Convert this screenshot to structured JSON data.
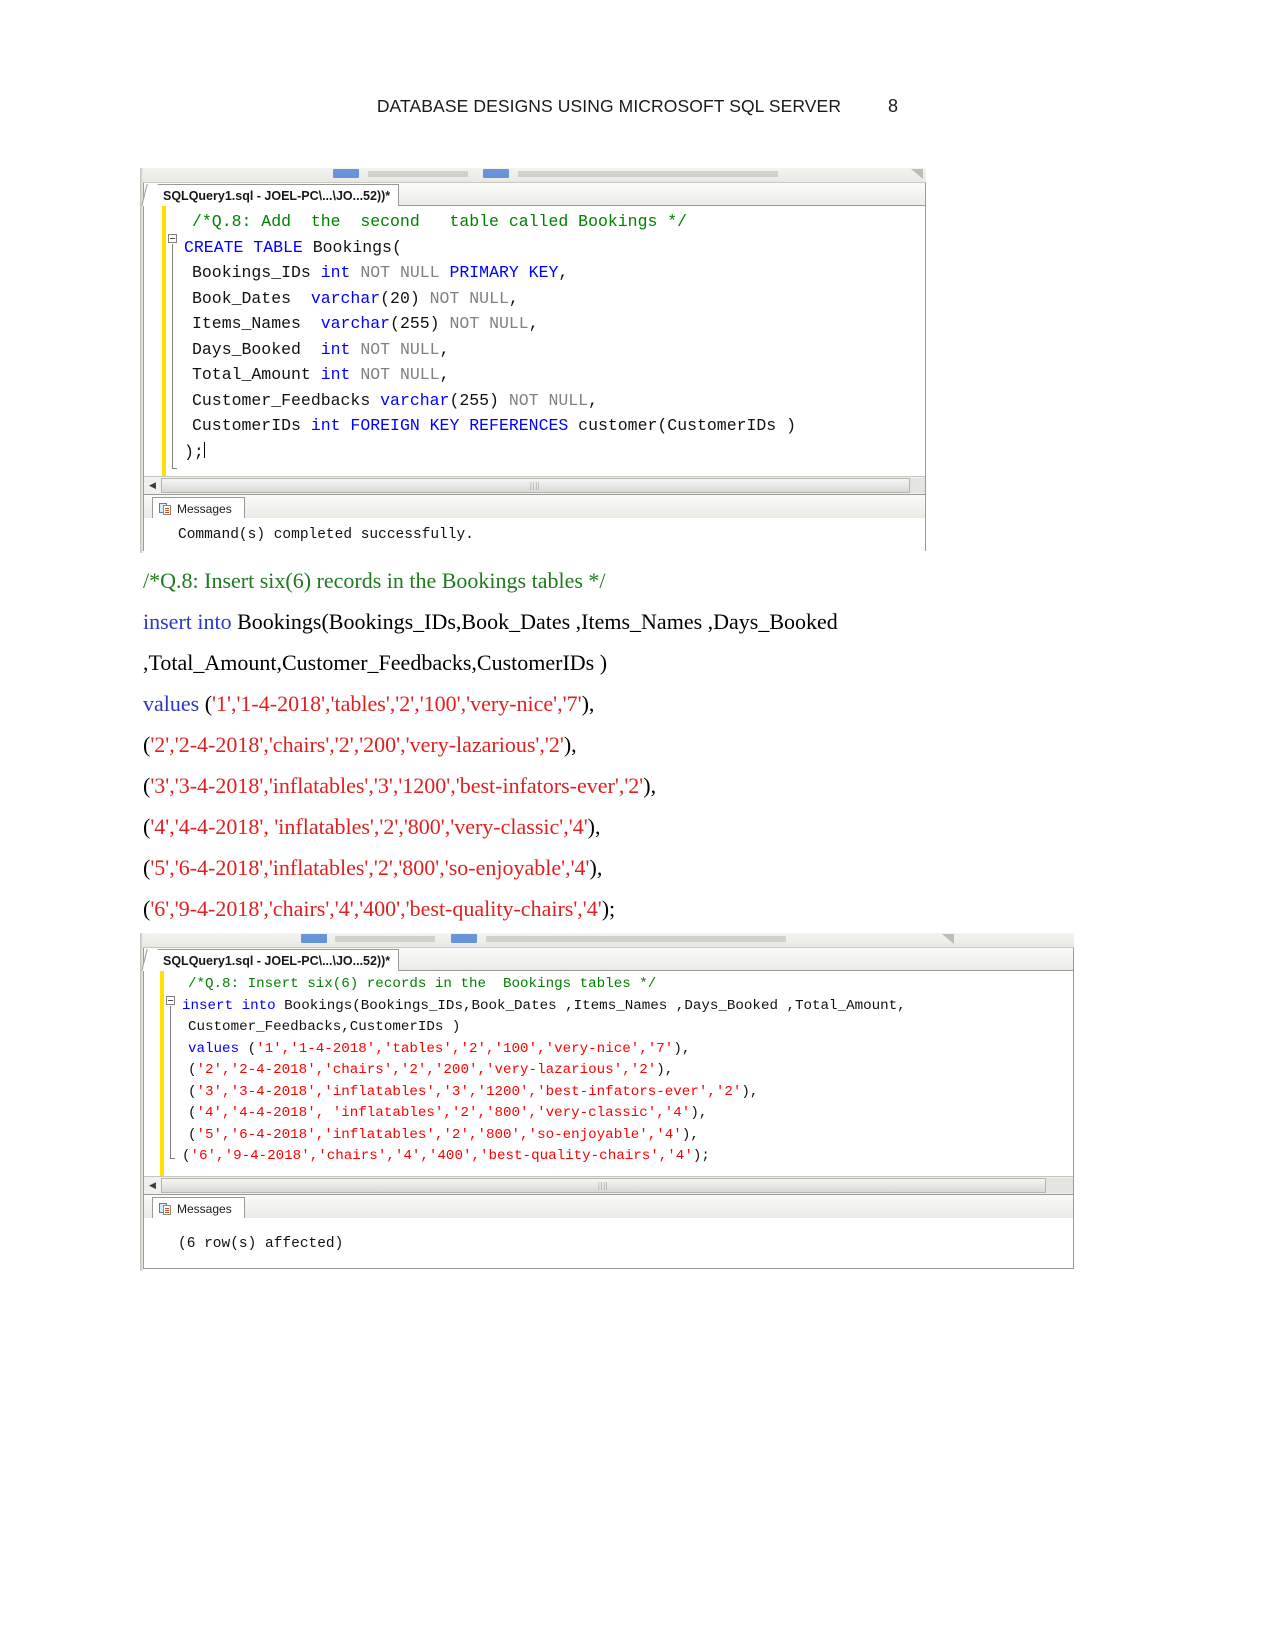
{
  "header": {
    "title": "DATABASE DESIGNS USING MICROSOFT SQL SERVER",
    "page_number": "8"
  },
  "screenshot1": {
    "tab_label": "SQLQuery1.sql - JOEL-PC\\...\\JO...52))*",
    "code_lines": [
      {
        "indent": 1,
        "segments": [
          {
            "t": "/*Q.8: Add  the  second   table called Bookings */",
            "c": "cmt"
          }
        ]
      },
      {
        "indent": 0,
        "segments": [
          {
            "t": "CREATE TABLE ",
            "c": "kw"
          },
          {
            "t": "Bookings(",
            "c": ""
          }
        ]
      },
      {
        "indent": 1,
        "segments": [
          {
            "t": "Bookings_IDs ",
            "c": ""
          },
          {
            "t": "int ",
            "c": "kw"
          },
          {
            "t": "NOT NULL ",
            "c": "grey"
          },
          {
            "t": "PRIMARY KEY",
            "c": "kw"
          },
          {
            "t": ",",
            "c": ""
          }
        ]
      },
      {
        "indent": 1,
        "segments": [
          {
            "t": "Book_Dates  ",
            "c": ""
          },
          {
            "t": "varchar",
            "c": "kw"
          },
          {
            "t": "(20) ",
            "c": ""
          },
          {
            "t": "NOT NULL",
            "c": "grey"
          },
          {
            "t": ",",
            "c": ""
          }
        ]
      },
      {
        "indent": 1,
        "segments": [
          {
            "t": "Items_Names  ",
            "c": ""
          },
          {
            "t": "varchar",
            "c": "kw"
          },
          {
            "t": "(255) ",
            "c": ""
          },
          {
            "t": "NOT NULL",
            "c": "grey"
          },
          {
            "t": ",",
            "c": ""
          }
        ]
      },
      {
        "indent": 1,
        "segments": [
          {
            "t": "Days_Booked  ",
            "c": ""
          },
          {
            "t": "int ",
            "c": "kw"
          },
          {
            "t": "NOT NULL",
            "c": "grey"
          },
          {
            "t": ",",
            "c": ""
          }
        ]
      },
      {
        "indent": 1,
        "segments": [
          {
            "t": "Total_Amount ",
            "c": ""
          },
          {
            "t": "int ",
            "c": "kw"
          },
          {
            "t": "NOT NULL",
            "c": "grey"
          },
          {
            "t": ",",
            "c": ""
          }
        ]
      },
      {
        "indent": 1,
        "segments": [
          {
            "t": "Customer_Feedbacks ",
            "c": ""
          },
          {
            "t": "varchar",
            "c": "kw"
          },
          {
            "t": "(255) ",
            "c": ""
          },
          {
            "t": "NOT NULL",
            "c": "grey"
          },
          {
            "t": ",",
            "c": ""
          }
        ]
      },
      {
        "indent": 1,
        "segments": [
          {
            "t": "CustomerIDs ",
            "c": ""
          },
          {
            "t": "int FOREIGN KEY REFERENCES ",
            "c": "kw"
          },
          {
            "t": "customer(CustomerIDs )",
            "c": ""
          }
        ]
      },
      {
        "indent": 0,
        "segments": [
          {
            "t": ");",
            "c": ""
          }
        ]
      }
    ],
    "messages_tab_label": "Messages",
    "message_text": "Command(s) completed successfully."
  },
  "document_text": {
    "lines": [
      {
        "segments": [
          {
            "t": "/*Q.8: Insert six(6) records in the  Bookings tables */",
            "c": "green"
          }
        ]
      },
      {
        "segments": [
          {
            "t": "insert into ",
            "c": "blue"
          },
          {
            "t": "Bookings(Bookings_IDs,Book_Dates ,Items_Names ,Days_Booked",
            "c": "black"
          }
        ]
      },
      {
        "segments": [
          {
            "t": ",Total_Amount,Customer_Feedbacks,CustomerIDs )",
            "c": "black"
          }
        ]
      },
      {
        "segments": [
          {
            "t": "values ",
            "c": "blue"
          },
          {
            "t": "(",
            "c": "black"
          },
          {
            "t": "'1','1-4-2018','tables','2','100','very-nice','7'",
            "c": "red"
          },
          {
            "t": "),",
            "c": "black"
          }
        ]
      },
      {
        "segments": [
          {
            "t": "(",
            "c": "black"
          },
          {
            "t": "'2','2-4-2018','chairs','2','200','very-lazarious','2'",
            "c": "red"
          },
          {
            "t": "),",
            "c": "black"
          }
        ]
      },
      {
        "segments": [
          {
            "t": "(",
            "c": "black"
          },
          {
            "t": "'3','3-4-2018','inflatables','3','1200','best-infators-ever','2'",
            "c": "red"
          },
          {
            "t": "),",
            "c": "black"
          }
        ]
      },
      {
        "segments": [
          {
            "t": "(",
            "c": "black"
          },
          {
            "t": "'4','4-4-2018', 'inflatables','2','800','very-classic','4'",
            "c": "red"
          },
          {
            "t": "),",
            "c": "black"
          }
        ]
      },
      {
        "segments": [
          {
            "t": "(",
            "c": "black"
          },
          {
            "t": "'5','6-4-2018','inflatables','2','800','so-enjoyable','4'",
            "c": "red"
          },
          {
            "t": "),",
            "c": "black"
          }
        ]
      },
      {
        "segments": [
          {
            "t": "(",
            "c": "black"
          },
          {
            "t": "'6','9-4-2018','chairs','4','400','best-quality-chairs','4'",
            "c": "red"
          },
          {
            "t": ");",
            "c": "black"
          }
        ]
      }
    ]
  },
  "screenshot2": {
    "tab_label": "SQLQuery1.sql - JOEL-PC\\...\\JO...52))*",
    "code_lines": [
      {
        "indent": 1,
        "segments": [
          {
            "t": "/*Q.8: Insert six(6) records in the  Bookings tables */",
            "c": "cmt"
          }
        ]
      },
      {
        "indent": 0,
        "segments": [
          {
            "t": "insert into ",
            "c": "kw"
          },
          {
            "t": "Bookings(Bookings_IDs,Book_Dates ,Items_Names ,Days_Booked ,Total_Amount,",
            "c": ""
          }
        ]
      },
      {
        "indent": 1,
        "segments": [
          {
            "t": "Customer_Feedbacks,CustomerIDs )",
            "c": ""
          }
        ]
      },
      {
        "indent": 1,
        "segments": [
          {
            "t": "values ",
            "c": "kw"
          },
          {
            "t": "(",
            "c": ""
          },
          {
            "t": "'1','1-4-2018','tables','2','100','very-nice','7'",
            "c": "str"
          },
          {
            "t": "),",
            "c": ""
          }
        ]
      },
      {
        "indent": 1,
        "segments": [
          {
            "t": "(",
            "c": ""
          },
          {
            "t": "'2','2-4-2018','chairs','2','200','very-lazarious','2'",
            "c": "str"
          },
          {
            "t": "),",
            "c": ""
          }
        ]
      },
      {
        "indent": 1,
        "segments": [
          {
            "t": "(",
            "c": ""
          },
          {
            "t": "'3','3-4-2018','inflatables','3','1200','best-infators-ever','2'",
            "c": "str"
          },
          {
            "t": "),",
            "c": ""
          }
        ]
      },
      {
        "indent": 1,
        "segments": [
          {
            "t": "(",
            "c": ""
          },
          {
            "t": "'4','4-4-2018', 'inflatables','2','800','very-classic','4'",
            "c": "str"
          },
          {
            "t": "),",
            "c": ""
          }
        ]
      },
      {
        "indent": 1,
        "segments": [
          {
            "t": "(",
            "c": ""
          },
          {
            "t": "'5','6-4-2018','inflatables','2','800','so-enjoyable','4'",
            "c": "str"
          },
          {
            "t": "),",
            "c": ""
          }
        ]
      },
      {
        "indent": 0,
        "segments": [
          {
            "t": "(",
            "c": ""
          },
          {
            "t": "'6','9-4-2018','chairs','4','400','best-quality-chairs','4'",
            "c": "str"
          },
          {
            "t": ");",
            "c": ""
          }
        ]
      }
    ],
    "messages_tab_label": "Messages",
    "message_text": "(6 row(s) affected)"
  }
}
